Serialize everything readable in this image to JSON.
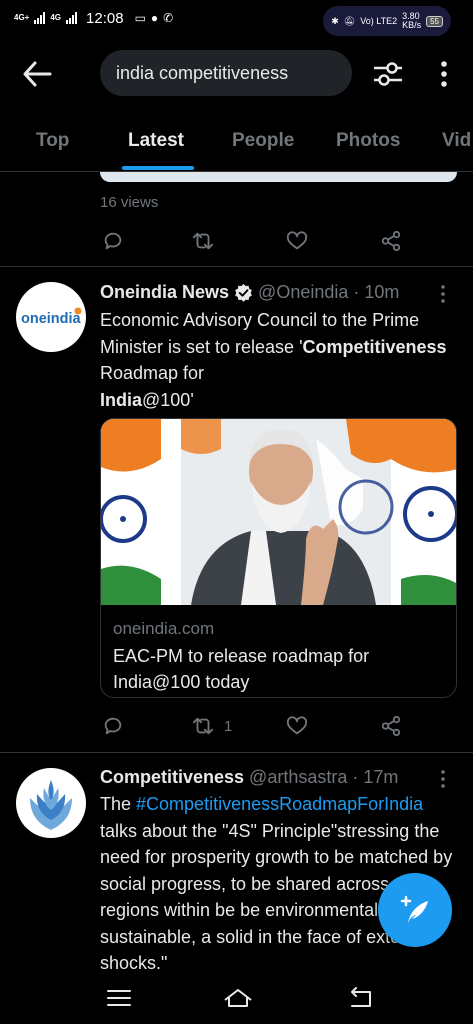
{
  "status_bar": {
    "net1": "4G+",
    "net2": "4G",
    "time": "12:08",
    "volte": "Vo) LTE2",
    "speed_value": "3.80",
    "speed_unit": "KB/s",
    "battery": "55"
  },
  "search": {
    "query": "india competitiveness"
  },
  "tabs": [
    {
      "label": "Top"
    },
    {
      "label": "Latest"
    },
    {
      "label": "People"
    },
    {
      "label": "Photos"
    },
    {
      "label": "Vid"
    }
  ],
  "active_tab": "Latest",
  "prev_tweet": {
    "views": "16 views"
  },
  "tweets": [
    {
      "name": "Oneindia News",
      "verified": true,
      "handle": "@Oneindia",
      "time": "· 10m",
      "avatar_text": "oneindia",
      "text_1": "Economic Advisory Council to the Prime Minister is set to release '",
      "text_bold_1": "Competitiveness",
      "text_2": " Roadmap for ",
      "text_bold_2": "India",
      "text_3": "@100'",
      "card": {
        "domain": "oneindia.com",
        "title": "EAC-PM to release roadmap for India@100 today"
      },
      "retweets": "1"
    },
    {
      "name": "Competitiveness",
      "handle": "@arthsastra",
      "time": "· 17m",
      "text_pre": "The ",
      "hashtag": "#CompetitivenessRoadmapForIndia",
      "text_post": " talks about the \"4S\" Principle\"stressing the need for prosperity growth to be matched by social progress, to be shared across all regions within be be environmentally sustainable, a solid in the face of external shocks.\""
    }
  ],
  "colors": {
    "accent": "#1d9bf0",
    "muted": "#71767b",
    "text": "#e7e9ea",
    "background": "#000000"
  }
}
